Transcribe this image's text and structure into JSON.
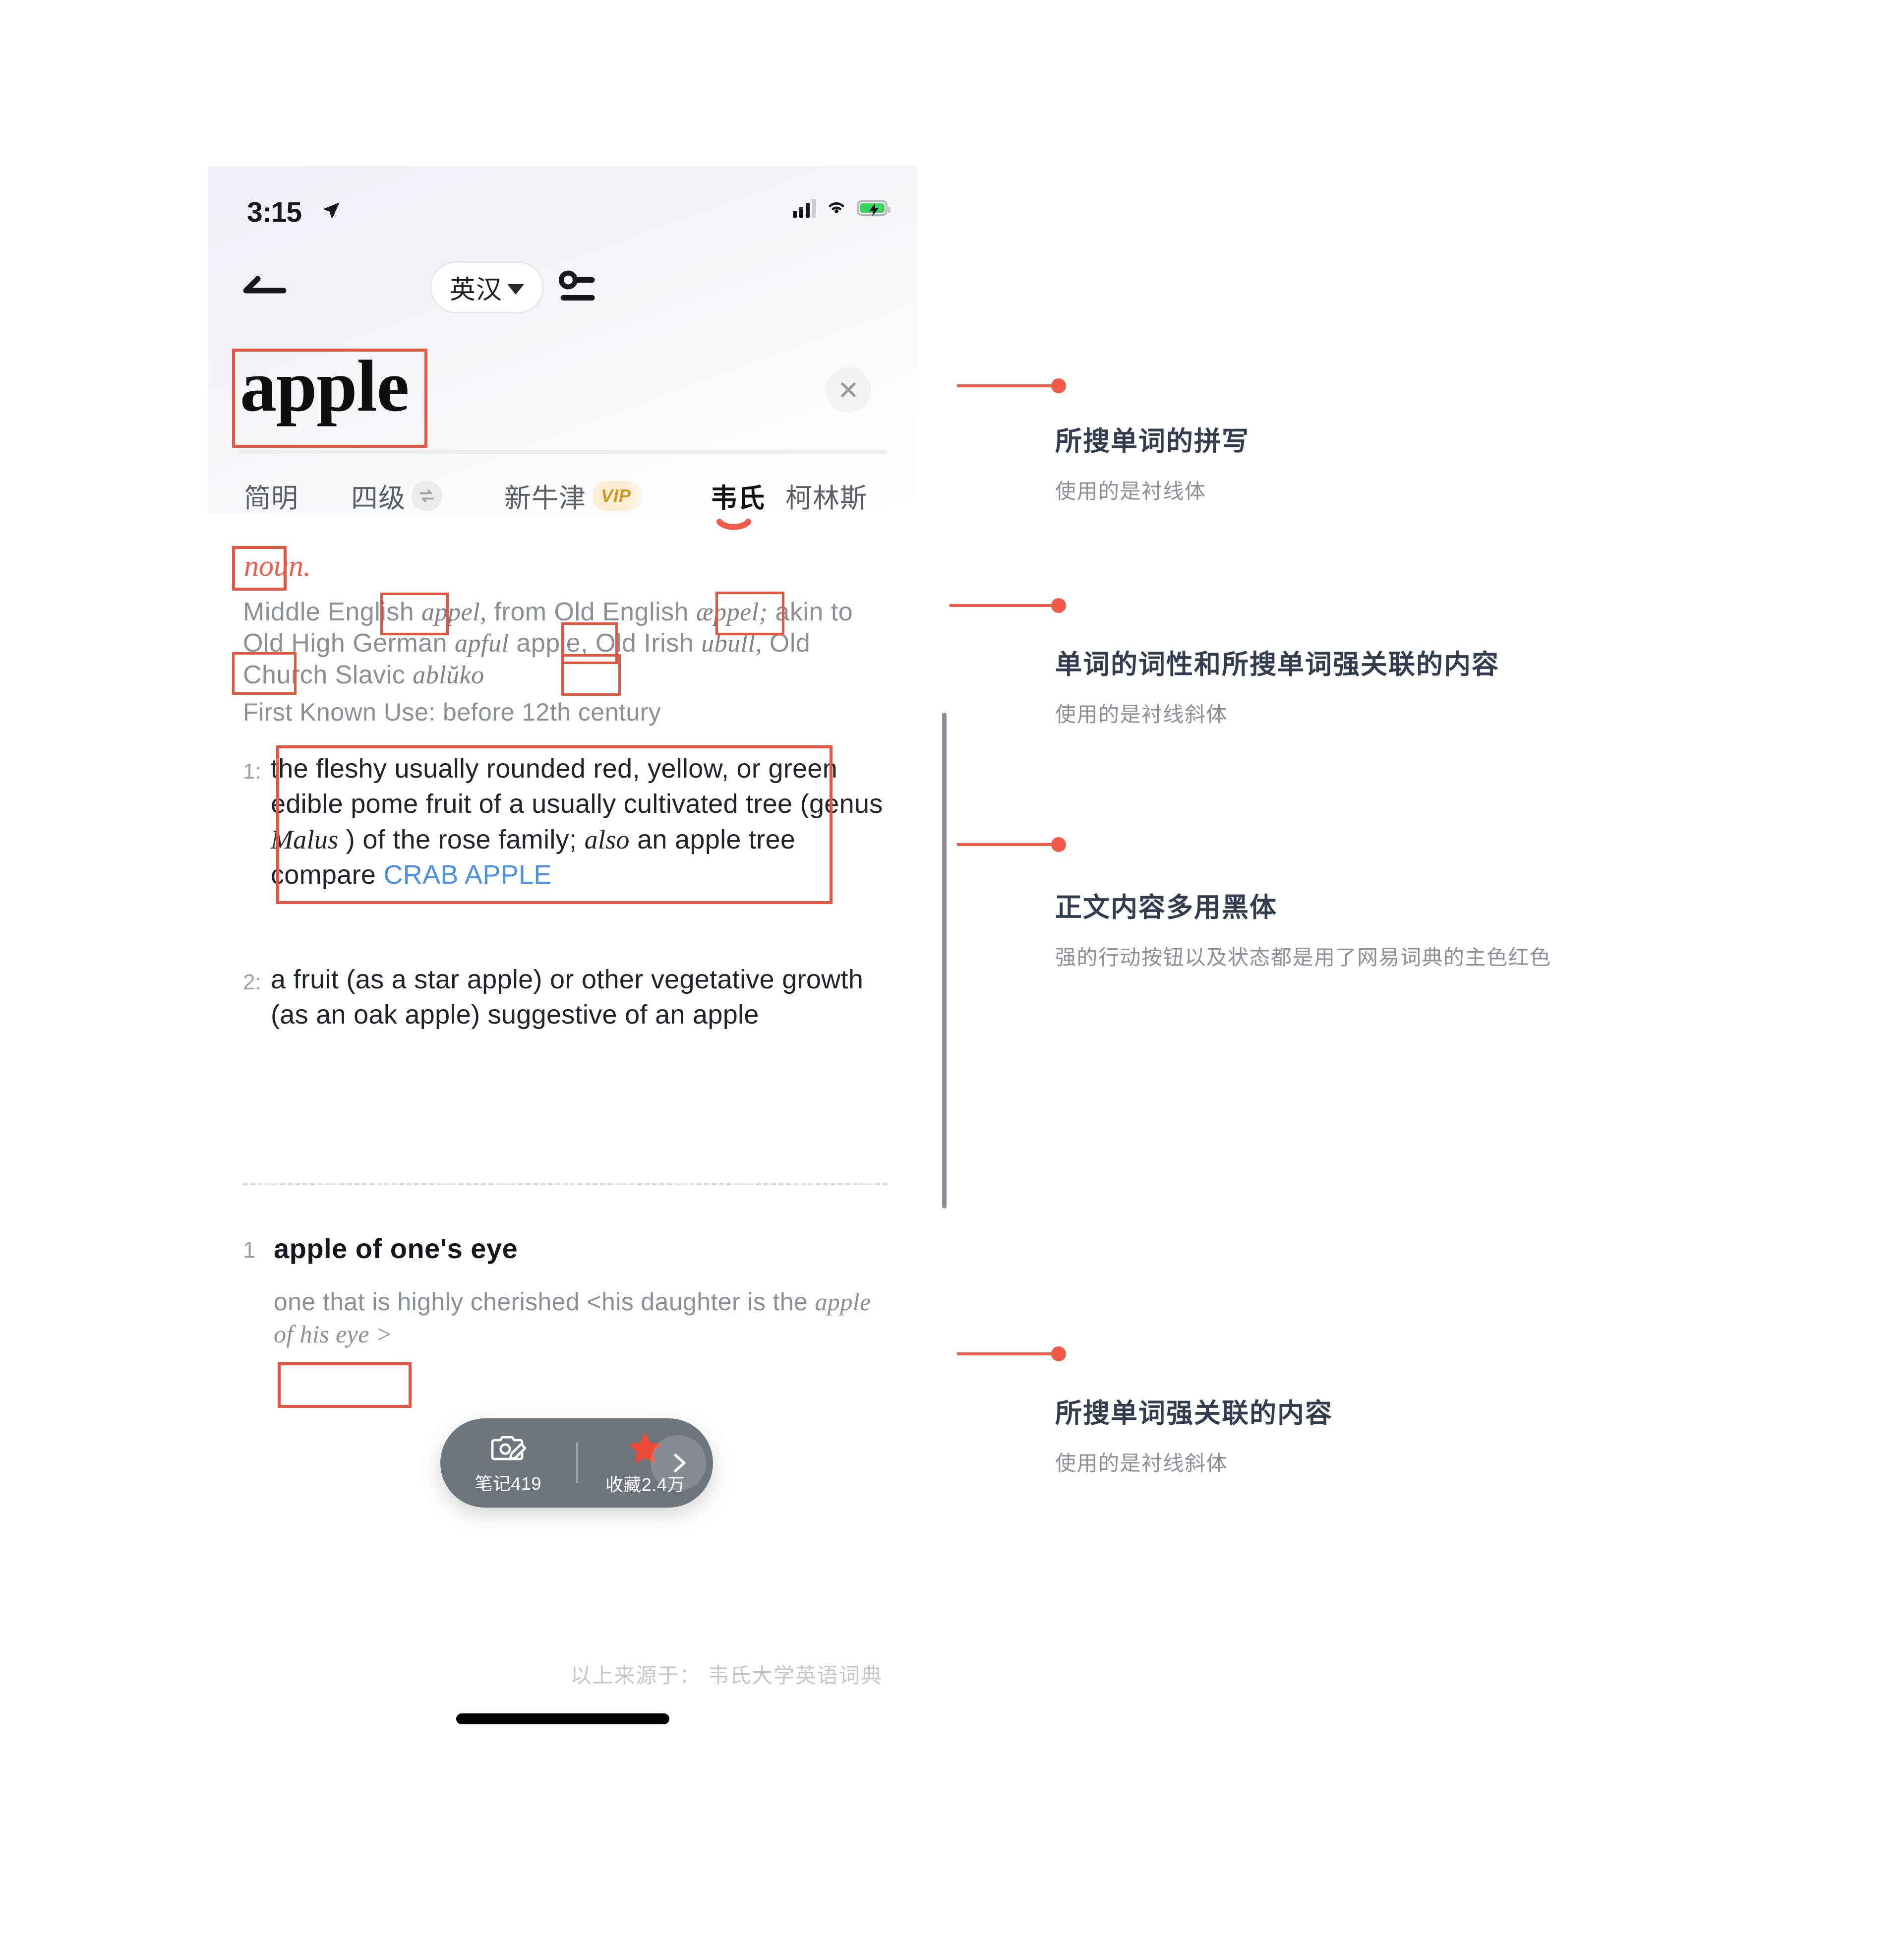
{
  "status_bar": {
    "time": "3:15",
    "location_icon": "location-arrow-icon",
    "signal_icon": "cellular-signal-icon",
    "wifi_icon": "wifi-icon",
    "battery_icon": "battery-charging-icon"
  },
  "nav": {
    "back_icon": "back-arrow-icon",
    "language_toggle": "英汉",
    "caret_icon": "chevron-down-icon",
    "settings_icon": "settings-sliders-icon"
  },
  "search": {
    "word": "apple",
    "clear_icon": "close-icon"
  },
  "tabs": [
    {
      "label": "简明",
      "badge": null,
      "active": false
    },
    {
      "label": "四级",
      "badge": "swap-icon",
      "active": false
    },
    {
      "label": "新牛津",
      "badge": "VIP",
      "active": false
    },
    {
      "label": "韦氏",
      "badge": null,
      "active": true
    },
    {
      "label": "柯林斯",
      "badge": null,
      "active": false
    }
  ],
  "entry": {
    "part_of_speech": "noun.",
    "etymology_prefix": "Middle English ",
    "etymology_it1": "appel,",
    "etymology_mid1": " from Old English ",
    "etymology_it2": "æppel;",
    "etymology_mid2": " akin to Old High German ",
    "etymology_it3": "apful",
    "etymology_mid3": " apple, Old Irish ",
    "etymology_it4": "ubull,",
    "etymology_mid4": " Old Church Slavic ",
    "etymology_it5": "ablŭko",
    "first_known_use": "First Known Use: before 12th century",
    "definitions": [
      {
        "num": "1:",
        "part1": "the fleshy usually rounded red, yellow, or green edible pome fruit of a usually cultivated tree (genus ",
        "italic1": "Malus",
        "part2": " ) of the rose family; ",
        "italic2": "also",
        "part3": " an apple tree compare ",
        "link": "CRAB APPLE"
      },
      {
        "num": "2:",
        "part1": "a fruit (as a star apple) or other vegetative growth (as an oak apple) suggestive of an apple",
        "italic1": "",
        "part2": "",
        "italic2": "",
        "part3": "",
        "link": ""
      }
    ],
    "idiom": {
      "num": "1",
      "title": "apple of one's eye",
      "def_prefix": "one that is highly cherished <his daughter is the ",
      "def_italic": "apple of his eye >"
    },
    "source_note": "以上来源于： 韦氏大学英语词典"
  },
  "action_bar": {
    "note_icon": "note-camera-icon",
    "note_label": "笔记419",
    "star_icon": "star-icon",
    "star_label": "收藏2.4万",
    "expand_icon": "chevron-right-icon"
  },
  "annotations": [
    {
      "title": "所搜单词的拼写",
      "sub": "使用的是衬线体"
    },
    {
      "title": "单词的词性和所搜单词强关联的内容",
      "sub": "使用的是衬线斜体"
    },
    {
      "title": "正文内容多用黑体",
      "sub": "强的行动按钮以及状态都是用了网易词典的主色红色"
    },
    {
      "title": "所搜单词强关联的内容",
      "sub": "使用的是衬线斜体"
    }
  ],
  "colors": {
    "accent_red": "#ef5c4a",
    "highlight_box": "#e8543f",
    "link_blue": "#4a90e8",
    "vip_gold": "#d19722",
    "anno_title": "#333d4f",
    "anno_sub": "#8c9199"
  }
}
